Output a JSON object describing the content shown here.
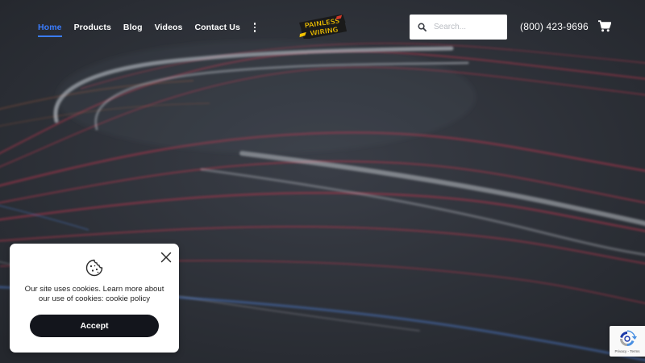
{
  "nav": {
    "items": [
      {
        "label": "Home",
        "active": true
      },
      {
        "label": "Products",
        "active": false
      },
      {
        "label": "Blog",
        "active": false
      },
      {
        "label": "Videos",
        "active": false
      },
      {
        "label": "Contact Us",
        "active": false
      }
    ],
    "more_icon": "vertical-dots-icon",
    "active_color": "#3b7dff"
  },
  "logo": {
    "lines": [
      "PAINLESS",
      "WIRING"
    ],
    "icon": "painless-wiring-logo",
    "colors": {
      "yellow": "#f5c400",
      "dark": "#1a1a1a"
    }
  },
  "search": {
    "placeholder": "Search...",
    "value": "",
    "icon": "search-icon"
  },
  "header": {
    "phone": "(800) 423-9696",
    "cart_icon": "shopping-cart-icon"
  },
  "cookie_banner": {
    "icon": "cookie-icon",
    "close_icon": "close-icon",
    "text": "Our site uses cookies. Learn more about our use of cookies:",
    "link_text": "cookie policy",
    "accept_label": "Accept"
  },
  "recaptcha": {
    "icon": "recaptcha-icon",
    "terms": "Privacy - Terms"
  },
  "colors": {
    "background": "#2c2f36",
    "accent": "#3b7dff",
    "light_trail_red": "#b8334a",
    "light_trail_white": "#d9dde3"
  }
}
